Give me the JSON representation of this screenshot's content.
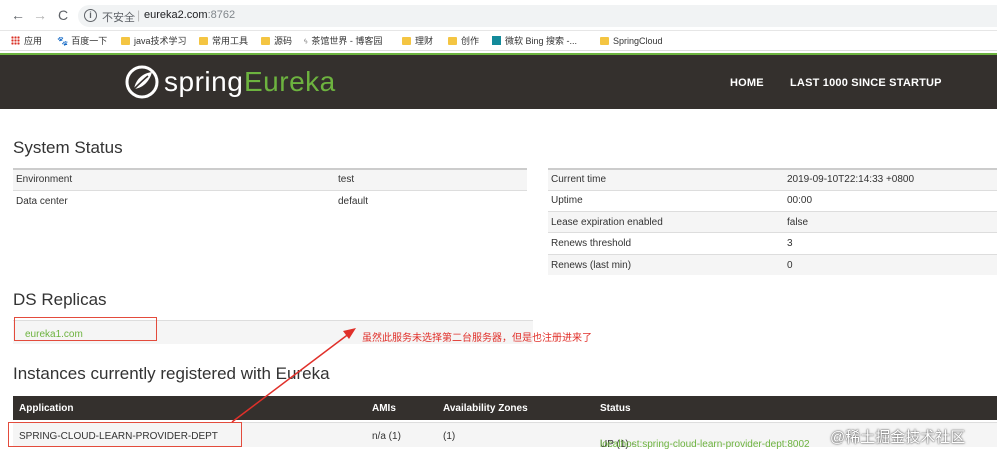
{
  "browser": {
    "back_glyph": "←",
    "forward_glyph": "→",
    "reload_glyph": "C",
    "info_glyph": "i",
    "insecure_label": "不安全",
    "separator": "|",
    "host": "eureka2.com",
    "port": ":8762"
  },
  "bookmarks": [
    {
      "label": "应用",
      "icon": "apps-grid-icon"
    },
    {
      "label": "百度一下",
      "icon": "baidu-paw-icon"
    },
    {
      "label": "java技术学习",
      "icon": "folder-icon"
    },
    {
      "label": "常用工具",
      "icon": "folder-icon"
    },
    {
      "label": "源码",
      "icon": "folder-icon"
    },
    {
      "label": "茶馆世界 - 博客园",
      "icon": "cnblogs-icon"
    },
    {
      "label": "理财",
      "icon": "folder-icon"
    },
    {
      "label": "创作",
      "icon": "folder-icon"
    },
    {
      "label": "微软 Bing 搜索 -...",
      "icon": "bing-icon"
    },
    {
      "label": "SpringCloud",
      "icon": "folder-icon"
    }
  ],
  "header": {
    "logo_spring": "spring",
    "logo_eureka": "Eureka",
    "nav": [
      "HOME",
      "LAST 1000 SINCE STARTUP"
    ],
    "bg_color": "#34302d",
    "accent_color": "#6db33f"
  },
  "system_status": {
    "title": "System Status",
    "left": [
      {
        "label": "Environment",
        "value": "test"
      },
      {
        "label": "Data center",
        "value": "default"
      }
    ],
    "right": [
      {
        "label": "Current time",
        "value": "2019-09-10T22:14:33 +0800"
      },
      {
        "label": "Uptime",
        "value": "00:00"
      },
      {
        "label": "Lease expiration enabled",
        "value": "false"
      },
      {
        "label": "Renews threshold",
        "value": "3"
      },
      {
        "label": "Renews (last min)",
        "value": "0"
      }
    ]
  },
  "replicas": {
    "title": "DS Replicas",
    "items": [
      "eureka1.com"
    ]
  },
  "annotation": {
    "text": "虽然此服务未选择第二台服务器，但是也注册进来了",
    "color": "#e0302a"
  },
  "instances": {
    "title": "Instances currently registered with Eureka",
    "columns": [
      "Application",
      "AMIs",
      "Availability Zones",
      "Status"
    ],
    "rows": [
      {
        "application": "SPRING-CLOUD-LEARN-PROVIDER-DEPT",
        "amis": "n/a (1)",
        "zones": "(1)",
        "status_prefix": "UP (1) - ",
        "status_link": "localhost:spring-cloud-learn-provider-dept:8002"
      }
    ]
  },
  "watermark": "@稀土掘金技术社区"
}
